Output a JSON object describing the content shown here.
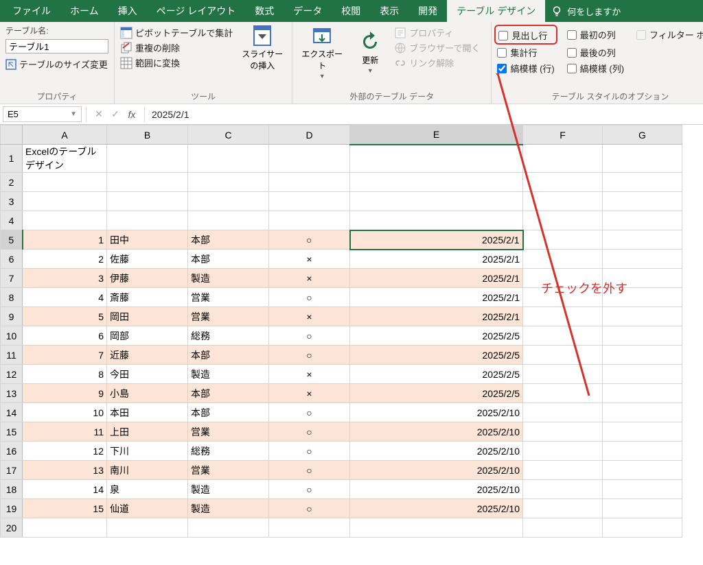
{
  "tabs": [
    "ファイル",
    "ホーム",
    "挿入",
    "ページ レイアウト",
    "数式",
    "データ",
    "校閲",
    "表示",
    "開発",
    "テーブル デザイン"
  ],
  "activeTab": 9,
  "tellMe": "何をしますか",
  "props": {
    "tableNameLabel": "テーブル名:",
    "tableName": "テーブル1",
    "resize": "テーブルのサイズ変更",
    "groupLabel": "プロパティ"
  },
  "tools": {
    "pivot": "ピボットテーブルで集計",
    "dup": "重複の削除",
    "range": "範囲に変換",
    "slicer": "スライサーの挿入",
    "groupLabel": "ツール"
  },
  "ext": {
    "export": "エクスポート",
    "refresh": "更新",
    "prop": "プロパティ",
    "browser": "ブラウザーで開く",
    "unlink": "リンク解除",
    "groupLabel": "外部のテーブル データ"
  },
  "styleOptions": {
    "headerRow": "見出し行",
    "totalRow": "集計行",
    "bandedRows": "縞模様 (行)",
    "firstCol": "最初の列",
    "lastCol": "最後の列",
    "bandedCols": "縞模様 (列)",
    "filterBtn": "フィルター ボタン",
    "groupLabel": "テーブル スタイルのオプション"
  },
  "nameBox": "E5",
  "formula": "2025/2/1",
  "cols": [
    "A",
    "B",
    "C",
    "D",
    "E",
    "F",
    "G"
  ],
  "selCol": "E",
  "selRow": 5,
  "a1": "Excelのテーブルデザイン",
  "rows": [
    {
      "n": 1,
      "name": "田中",
      "dept": "本部",
      "mark": "○",
      "date": "2025/2/1"
    },
    {
      "n": 2,
      "name": "佐藤",
      "dept": "本部",
      "mark": "×",
      "date": "2025/2/1"
    },
    {
      "n": 3,
      "name": "伊藤",
      "dept": "製造",
      "mark": "×",
      "date": "2025/2/1"
    },
    {
      "n": 4,
      "name": "斎藤",
      "dept": "営業",
      "mark": "○",
      "date": "2025/2/1"
    },
    {
      "n": 5,
      "name": "岡田",
      "dept": "営業",
      "mark": "×",
      "date": "2025/2/1"
    },
    {
      "n": 6,
      "name": "岡部",
      "dept": "総務",
      "mark": "○",
      "date": "2025/2/5"
    },
    {
      "n": 7,
      "name": "近藤",
      "dept": "本部",
      "mark": "○",
      "date": "2025/2/5"
    },
    {
      "n": 8,
      "name": "今田",
      "dept": "製造",
      "mark": "×",
      "date": "2025/2/5"
    },
    {
      "n": 9,
      "name": "小島",
      "dept": "本部",
      "mark": "×",
      "date": "2025/2/5"
    },
    {
      "n": 10,
      "name": "本田",
      "dept": "本部",
      "mark": "○",
      "date": "2025/2/10"
    },
    {
      "n": 11,
      "name": "上田",
      "dept": "営業",
      "mark": "○",
      "date": "2025/2/10"
    },
    {
      "n": 12,
      "name": "下川",
      "dept": "総務",
      "mark": "○",
      "date": "2025/2/10"
    },
    {
      "n": 13,
      "name": "南川",
      "dept": "営業",
      "mark": "○",
      "date": "2025/2/10"
    },
    {
      "n": 14,
      "name": "泉",
      "dept": "製造",
      "mark": "○",
      "date": "2025/2/10"
    },
    {
      "n": 15,
      "name": "仙道",
      "dept": "製造",
      "mark": "○",
      "date": "2025/2/10"
    }
  ],
  "annotation": "チェックを外す"
}
